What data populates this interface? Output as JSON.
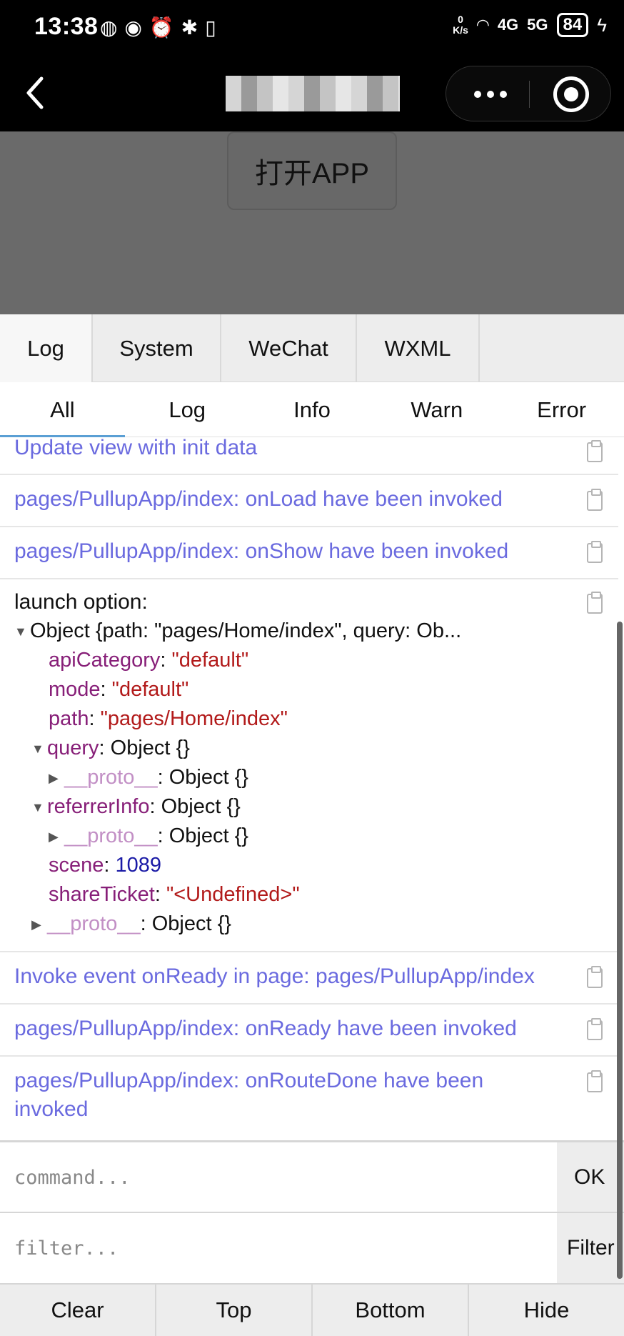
{
  "status_bar": {
    "time": "13:38",
    "net_speed_value": "0",
    "net_speed_unit": "K/s",
    "signal_1": "4G",
    "signal_2": "5G",
    "battery": "84"
  },
  "nav": {
    "back_icon": "chevron-left-icon",
    "more_icon": "more-dots-icon",
    "close_icon": "target-circle-icon"
  },
  "page": {
    "open_app_label": "打开APP"
  },
  "console": {
    "tabs": [
      "Log",
      "System",
      "WeChat",
      "WXML"
    ],
    "subtabs": [
      "All",
      "Log",
      "Info",
      "Warn",
      "Error"
    ],
    "logs": {
      "l1": "Update view with init data",
      "l2": "pages/PullupApp/index: onLoad have been invoked",
      "l3": "pages/PullupApp/index: onShow have been invoked",
      "l4_title": "launch option:",
      "l5": "Invoke event onReady in page: pages/PullupApp/index",
      "l6": "pages/PullupApp/index: onReady have been invoked",
      "l7_line1": "pages/PullupApp/index: onRouteDone have been",
      "l7_line2": "invoked"
    },
    "tree": {
      "root": "Object {path: \"pages/Home/index\", query: Ob...",
      "apiCategory_key": "apiCategory",
      "apiCategory_val": "\"default\"",
      "mode_key": "mode",
      "mode_val": "\"default\"",
      "path_key": "path",
      "path_val": "\"pages/Home/index\"",
      "query_key": "query",
      "query_val": "Object {}",
      "proto_key": "__proto__",
      "proto_val": "Object {}",
      "referrer_key": "referrerInfo",
      "referrer_val": "Object {}",
      "scene_key": "scene",
      "scene_val": "1089",
      "shareTicket_key": "shareTicket",
      "shareTicket_val": "\"<Undefined>\""
    },
    "command_placeholder": "command...",
    "ok_label": "OK",
    "filter_placeholder": "filter...",
    "filter_label": "Filter",
    "toolbar": [
      "Clear",
      "Top",
      "Bottom",
      "Hide"
    ]
  }
}
